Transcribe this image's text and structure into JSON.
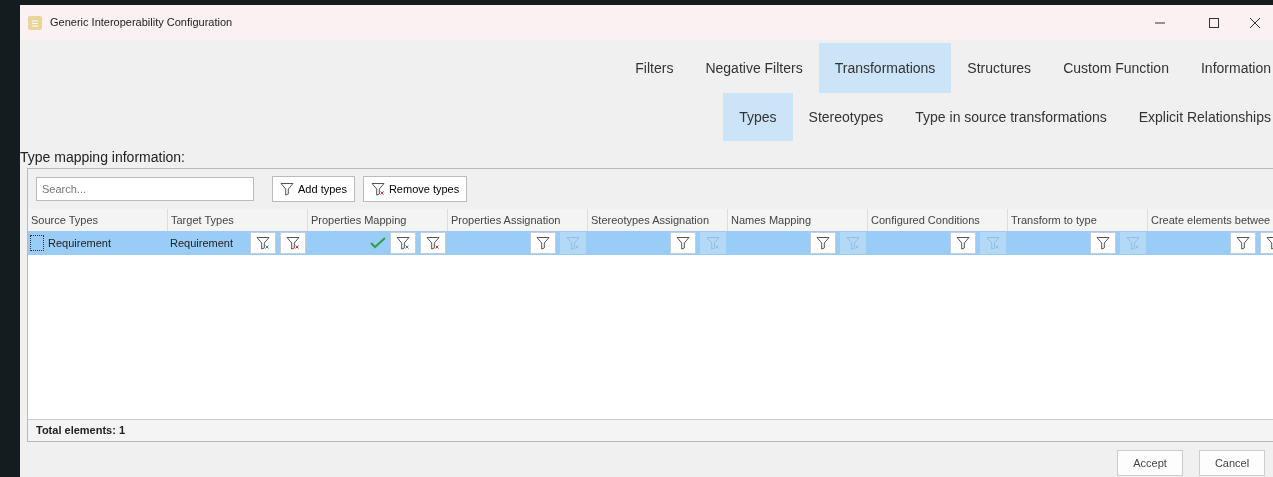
{
  "window": {
    "title": "Generic Interoperability Configuration"
  },
  "tabs": [
    {
      "label": "Filters",
      "selected": false
    },
    {
      "label": "Negative Filters",
      "selected": false
    },
    {
      "label": "Transformations",
      "selected": true
    },
    {
      "label": "Structures",
      "selected": false
    },
    {
      "label": "Custom Function",
      "selected": false
    },
    {
      "label": "Information",
      "selected": false
    }
  ],
  "subtabs": [
    {
      "label": "Types",
      "selected": true
    },
    {
      "label": "Stereotypes",
      "selected": false
    },
    {
      "label": "Type in source transformations",
      "selected": false
    },
    {
      "label": "Explicit Relationships",
      "selected": false
    }
  ],
  "section_label": "Type mapping information:",
  "search": {
    "placeholder": "Search..."
  },
  "toolbar": [
    {
      "label": "Add types",
      "kind": "add"
    },
    {
      "label": "Remove types",
      "kind": "remove"
    }
  ],
  "table": {
    "columns": [
      "Source Types",
      "Target Types",
      "Properties Mapping",
      "Properties Assignation",
      "Stereotypes Assignation",
      "Names Mapping",
      "Configured Conditions",
      "Transform to type",
      "Create elements betwee"
    ],
    "rows": [
      {
        "selected": true,
        "cells": [
          {
            "text": "Requirement",
            "focus": true
          },
          {
            "text": "Requirement",
            "buttons": [
              {
                "kind": "edit",
                "disabled": false
              },
              {
                "kind": "remove",
                "disabled": false
              }
            ]
          },
          {
            "checked": true,
            "buttons": [
              {
                "kind": "edit",
                "disabled": false
              },
              {
                "kind": "remove",
                "disabled": false
              }
            ]
          },
          {
            "buttons": [
              {
                "kind": "plain",
                "disabled": false
              },
              {
                "kind": "edit",
                "disabled": true
              }
            ]
          },
          {
            "buttons": [
              {
                "kind": "plain",
                "disabled": false
              },
              {
                "kind": "edit",
                "disabled": true
              }
            ]
          },
          {
            "buttons": [
              {
                "kind": "plain",
                "disabled": false
              },
              {
                "kind": "edit",
                "disabled": true
              }
            ]
          },
          {
            "buttons": [
              {
                "kind": "plain",
                "disabled": false
              },
              {
                "kind": "edit",
                "disabled": true
              }
            ]
          },
          {
            "buttons": [
              {
                "kind": "plain",
                "disabled": false
              },
              {
                "kind": "edit",
                "disabled": true
              }
            ]
          },
          {
            "buttons": [
              {
                "kind": "plain",
                "disabled": false
              },
              {
                "kind": "remove",
                "disabled": false
              }
            ]
          }
        ]
      }
    ]
  },
  "footer": "Total elements: 1",
  "buttons": [
    "Accept",
    "Cancel"
  ]
}
